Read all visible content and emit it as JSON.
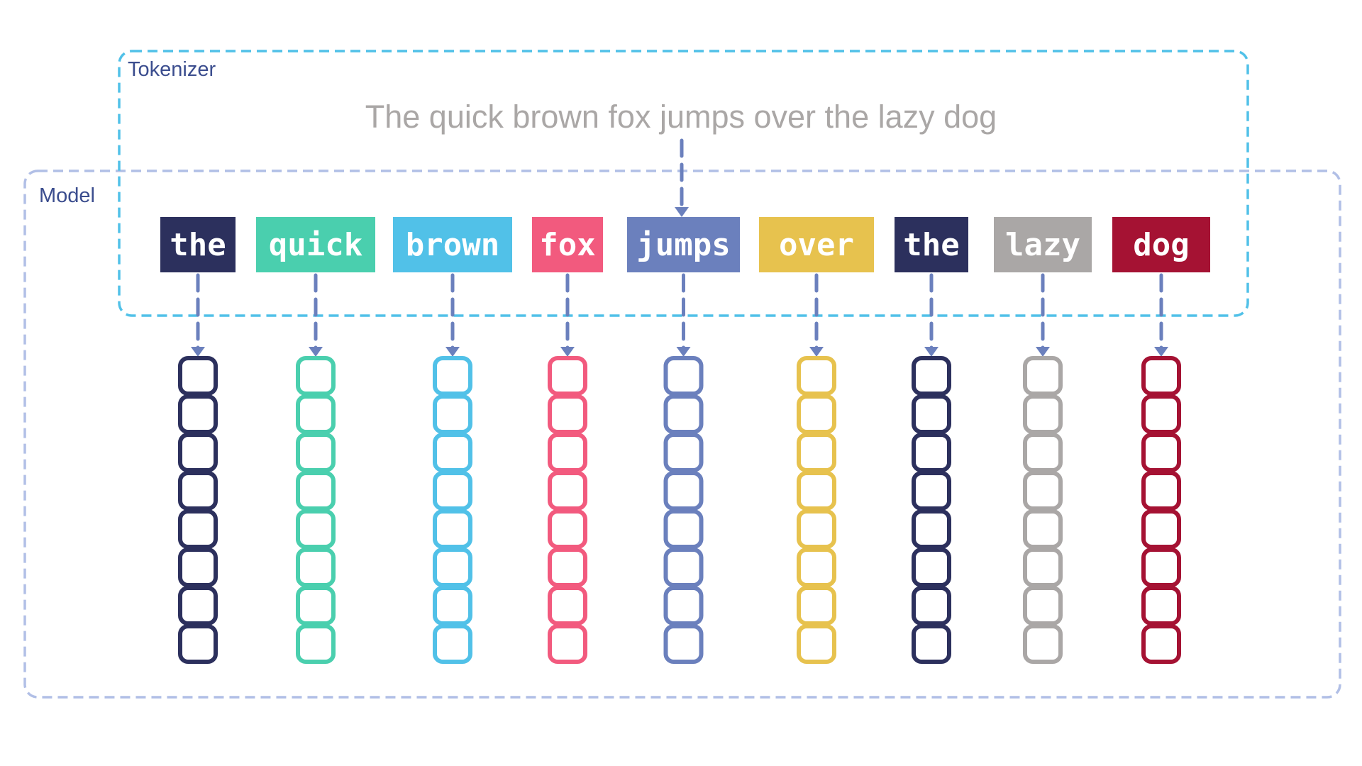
{
  "diagram": {
    "tokenizer": {
      "label": "Tokenizer",
      "border_color": "#51c1e8"
    },
    "model": {
      "label": "Model",
      "border_color": "#b1bfe6"
    },
    "input_sentence": "The quick brown fox jumps over the lazy dog",
    "arrow_color": "#6b80bd",
    "embedding_cells_per_token": 8,
    "tokens": [
      {
        "text": "the",
        "color": "#2c305d"
      },
      {
        "text": "quick",
        "color": "#4acfae"
      },
      {
        "text": "brown",
        "color": "#51c1e8"
      },
      {
        "text": "fox",
        "color": "#f25a7e"
      },
      {
        "text": "jumps",
        "color": "#6b80bd"
      },
      {
        "text": "over",
        "color": "#e7c24e"
      },
      {
        "text": "the",
        "color": "#2c305d"
      },
      {
        "text": "lazy",
        "color": "#aaa7a6"
      },
      {
        "text": "dog",
        "color": "#a51233"
      }
    ]
  }
}
